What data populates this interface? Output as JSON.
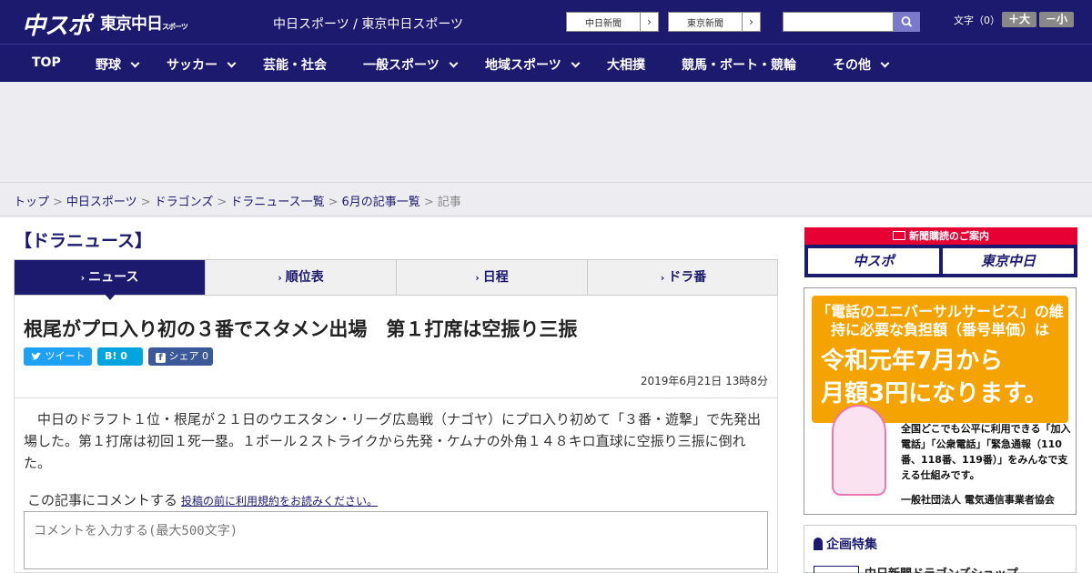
{
  "header": {
    "logo_chunichi": "中スポ",
    "logo_tokyo": "東京中日",
    "logo_tokyo_sub": "スポーツ",
    "site_title": "中日スポーツ / 東京中日スポーツ",
    "paper_links": [
      {
        "label": "中日新聞"
      },
      {
        "label": "東京新聞"
      }
    ],
    "search_placeholder": "",
    "font_label": "文字（0）",
    "font_plus": "＋大",
    "font_minus": "－小"
  },
  "nav": {
    "items": [
      {
        "label": "TOP",
        "dropdown": false
      },
      {
        "label": "野球",
        "dropdown": true
      },
      {
        "label": "サッカー",
        "dropdown": true
      },
      {
        "label": "芸能・社会",
        "dropdown": false
      },
      {
        "label": "一般スポーツ",
        "dropdown": true
      },
      {
        "label": "地域スポーツ",
        "dropdown": true
      },
      {
        "label": "大相撲",
        "dropdown": false
      },
      {
        "label": "競馬・ボート・競輪",
        "dropdown": false
      },
      {
        "label": "その他",
        "dropdown": true
      }
    ]
  },
  "breadcrumb": {
    "items": [
      "トップ",
      "中日スポーツ",
      "ドラゴンズ",
      "ドラニュース一覧",
      "6月の記事一覧"
    ],
    "current": "記事",
    "separator": ">"
  },
  "section": {
    "title": "【ドラニュース】"
  },
  "tabs": [
    {
      "label": "ニュース",
      "active": true
    },
    {
      "label": "順位表",
      "active": false
    },
    {
      "label": "日程",
      "active": false
    },
    {
      "label": "ドラ番",
      "active": false
    }
  ],
  "article": {
    "headline": "根尾がプロ入り初の３番でスタメン出場　第１打席は空振り三振",
    "share": {
      "tweet": "ツイート",
      "hatena": "B! 0",
      "facebook": "シェア 0"
    },
    "date": "2019年6月21日 13時8分",
    "body": "　中日のドラフト１位・根尾が２１日のウエスタン・リーグ広島戦（ナゴヤ）にプロ入り初めて「３番・遊撃」で先発出場した。第１打席は初回１死一塁。１ボール２ストライクから先発・ケムナの外角１４８キロ直球に空振り三振に倒れた。",
    "comment_label": "この記事にコメントする",
    "comment_terms_link": "投稿の前に利用規約をお読みください。",
    "comment_placeholder": "コメントを入力する(最大500文字)"
  },
  "sidebar": {
    "subscription": {
      "header": "新聞購読のご案内",
      "chunichi": "中スポ",
      "tokyo": "東京中日"
    },
    "univ_ad": {
      "line1": "「電話のユニバーサルサービス」の維持に必要な負担額（番号単価）は",
      "line2a": "令和元年7月から",
      "line2b": "月額3円になります。",
      "small": "全国どこでも公平に利用できる「加入電話」「公衆電話」「緊急通報（110番、118番、119番）」をみんなで支える仕組みです。",
      "org": "一般社団法人 電気通信事業者協会"
    },
    "kikaku": {
      "title": "企画特集",
      "item": "中日新聞ドラゴンズショップ"
    }
  }
}
